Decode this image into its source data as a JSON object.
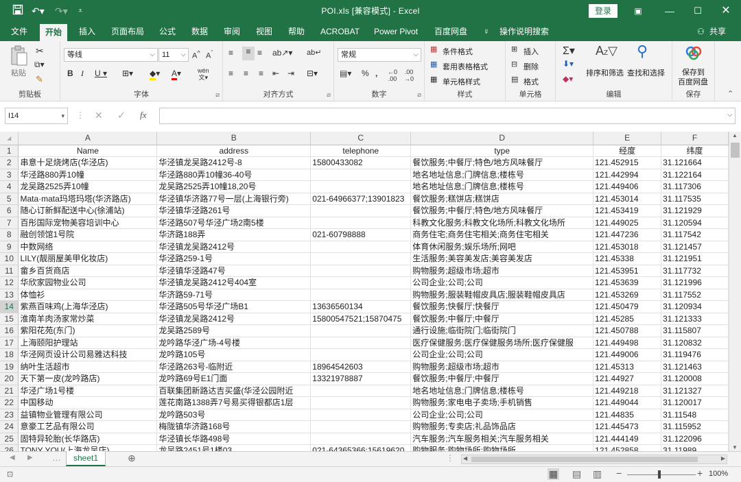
{
  "window": {
    "title": "POI.xls  [兼容模式]  -  Excel",
    "login_label": "登录"
  },
  "menu": {
    "tabs": [
      "文件",
      "开始",
      "插入",
      "页面布局",
      "公式",
      "数据",
      "审阅",
      "视图",
      "帮助",
      "ACROBAT",
      "Power Pivot",
      "百度网盘"
    ],
    "tell_me": "操作说明搜索",
    "share": "共享"
  },
  "ribbon": {
    "clipboard": {
      "paste": "粘贴",
      "label": "剪贴板"
    },
    "font": {
      "name": "等线",
      "size": "11",
      "label": "字体"
    },
    "alignment": {
      "label": "对齐方式"
    },
    "number": {
      "format": "常规",
      "label": "数字"
    },
    "styles": {
      "conditional": "条件格式",
      "table": "套用表格格式",
      "cell": "单元格样式",
      "label": "样式"
    },
    "cells": {
      "insert": "插入",
      "delete": "删除",
      "format": "格式",
      "label": "单元格"
    },
    "editing": {
      "sort": "排序和筛选",
      "find": "查找和选择",
      "label": "编辑"
    },
    "save": {
      "line1": "保存到",
      "line2": "百度网盘",
      "label": "保存"
    }
  },
  "formula_bar": {
    "name_box": "I14",
    "fx": "fx",
    "value": ""
  },
  "columns": [
    "A",
    "B",
    "C",
    "D",
    "E",
    "F"
  ],
  "rows": [
    {
      "n": "1",
      "a": "Name",
      "b": "address",
      "c": "telephone",
      "d": "type",
      "e": "经度",
      "f": "纬度"
    },
    {
      "n": "2",
      "a": "串意十足烧烤店(华泾店)",
      "b": "华泾镇龙吴路2412号-8",
      "c": "15800433082",
      "d": "餐饮服务;中餐厅;特色/地方风味餐厅",
      "e": "121.452915",
      "f": "31.121664"
    },
    {
      "n": "3",
      "a": "华泾路880弄10幢",
      "b": "华泾路880弄10幢36-40号",
      "c": "",
      "d": "地名地址信息;门牌信息;楼栋号",
      "e": "121.442994",
      "f": "31.122164"
    },
    {
      "n": "4",
      "a": "龙吴路2525弄10幢",
      "b": "龙吴路2525弄10幢18,20号",
      "c": "",
      "d": "地名地址信息;门牌信息;楼栋号",
      "e": "121.449406",
      "f": "31.117306"
    },
    {
      "n": "5",
      "a": "Mata·mata玛塔玛塔(华济路店)",
      "b": "华泾镇华济路77号一层(上海银行旁)",
      "c": "021-64966377;13901823",
      "d": "餐饮服务;糕饼店;糕饼店",
      "e": "121.453014",
      "f": "31.117535"
    },
    {
      "n": "6",
      "a": "随心订新鲜配送中心(徐浦站)",
      "b": "华泾镇华泾路261号",
      "c": "",
      "d": "餐饮服务;中餐厅;特色/地方风味餐厅",
      "e": "121.453419",
      "f": "31.121929"
    },
    {
      "n": "7",
      "a": "百彤国际宠物美容培训中心",
      "b": "华泾路507号华泾广场2南5楼",
      "c": "",
      "d": "科教文化服务;科教文化场所;科教文化场所",
      "e": "121.449025",
      "f": "31.120594"
    },
    {
      "n": "8",
      "a": "融创领馆1号院",
      "b": "华济路188弄",
      "c": "021-60798888",
      "d": "商务住宅;商务住宅相关;商务住宅相关",
      "e": "121.447236",
      "f": "31.117542"
    },
    {
      "n": "9",
      "a": "中数网络",
      "b": "华泾镇龙吴路2412号",
      "c": "",
      "d": "体育休闲服务;娱乐场所;网吧",
      "e": "121.453018",
      "f": "31.121457"
    },
    {
      "n": "10",
      "a": "LILY(靓丽屋美甲化妆店)",
      "b": "华泾路259-1号",
      "c": "",
      "d": "生活服务;美容美发店;美容美发店",
      "e": "121.45338",
      "f": "31.121951"
    },
    {
      "n": "11",
      "a": "畲乡百货商店",
      "b": "华泾镇华泾路47号",
      "c": "",
      "d": "购物服务;超级市场;超市",
      "e": "121.453951",
      "f": "31.117732"
    },
    {
      "n": "12",
      "a": "华欣家园物业公司",
      "b": "华泾镇龙吴路2412号404室",
      "c": "",
      "d": "公司企业;公司;公司",
      "e": "121.453639",
      "f": "31.121996"
    },
    {
      "n": "13",
      "a": "体恤衫",
      "b": "华济路59-71号",
      "c": "",
      "d": "购物服务;服装鞋帽皮具店;服装鞋帽皮具店",
      "e": "121.453269",
      "f": "31.117552"
    },
    {
      "n": "14",
      "a": "紫燕百味鸡(上海华泾店)",
      "b": "华泾路505号华泾广场B1",
      "c": "13636560134",
      "d": "餐饮服务;快餐厅;快餐厅",
      "e": "121.450479",
      "f": "31.120934"
    },
    {
      "n": "15",
      "a": "淮南羊肉汤家常炒菜",
      "b": "华泾镇龙吴路2412号",
      "c": "15800547521;15870475",
      "d": "餐饮服务;中餐厅;中餐厅",
      "e": "121.45285",
      "f": "31.121333"
    },
    {
      "n": "16",
      "a": "紫阳花苑(东门)",
      "b": "龙吴路2589号",
      "c": "",
      "d": "通行设施;临街院门;临街院门",
      "e": "121.450788",
      "f": "31.115807"
    },
    {
      "n": "17",
      "a": "上海颐阳护理站",
      "b": "龙吟路华泾广场-4号楼",
      "c": "",
      "d": "医疗保健服务;医疗保健服务场所;医疗保健服",
      "e": "121.449498",
      "f": "31.120832"
    },
    {
      "n": "18",
      "a": "华泾网页设计公司易雅达科技",
      "b": "龙吟路105号",
      "c": "",
      "d": "公司企业;公司;公司",
      "e": "121.449006",
      "f": "31.119476"
    },
    {
      "n": "19",
      "a": "纳叶生活超市",
      "b": "华泾路263号-临附近",
      "c": "18964542603",
      "d": "购物服务;超级市场;超市",
      "e": "121.45313",
      "f": "31.121463"
    },
    {
      "n": "20",
      "a": "天下第一皮(龙吟路店)",
      "b": "龙吟路69号E1门面",
      "c": "13321978887",
      "d": "餐饮服务;中餐厅;中餐厅",
      "e": "121.44927",
      "f": "31.120008"
    },
    {
      "n": "21",
      "a": "华泾广场1号楼",
      "b": "百联集团新路达吉买盛(华泾公园附近",
      "c": "",
      "d": "地名地址信息;门牌信息;楼栋号",
      "e": "121.449218",
      "f": "31.121327"
    },
    {
      "n": "22",
      "a": "中国移动",
      "b": "莲花南路1388弄7号易买得银都店1层",
      "c": "",
      "d": "购物服务;家电电子卖场;手机销售",
      "e": "121.449044",
      "f": "31.120017"
    },
    {
      "n": "23",
      "a": "益镇物业管理有限公司",
      "b": "龙吟路503号",
      "c": "",
      "d": "公司企业;公司;公司",
      "e": "121.44835",
      "f": "31.11548"
    },
    {
      "n": "24",
      "a": "意豪工艺品有限公司",
      "b": "梅陇镇华济路168号",
      "c": "",
      "d": "购物服务;专卖店;礼品饰品店",
      "e": "121.445473",
      "f": "31.115952"
    },
    {
      "n": "25",
      "a": "固特异轮胎(长华路店)",
      "b": "华泾镇长华路498号",
      "c": "",
      "d": "汽车服务;汽车服务相关;汽车服务相关",
      "e": "121.444149",
      "f": "31.122096"
    },
    {
      "n": "26",
      "a": "TONY YOU(上海龙吴店)",
      "b": "龙吴路2451号1楼03",
      "c": "021-64365366;15619620",
      "d": "购物服务;购物场所;购物场所",
      "e": "121.452858",
      "f": "31.11989"
    }
  ],
  "selected_row": "14",
  "sheet": {
    "tab": "sheet1"
  },
  "status": {
    "zoom": "100%"
  }
}
